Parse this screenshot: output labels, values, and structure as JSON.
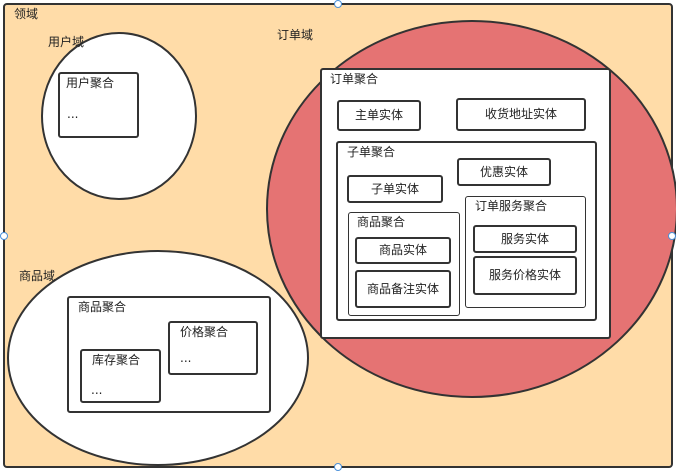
{
  "domain_label": "领域",
  "user_domain": {
    "label": "用户域",
    "user_aggregate": {
      "label": "用户聚合",
      "ellipsis": "..."
    }
  },
  "order_domain": {
    "label": "订单域",
    "order_aggregate": {
      "label": "订单聚合",
      "main_entity": "主单实体",
      "address_entity": "收货地址实体",
      "sub_aggregate": {
        "label": "子单聚合",
        "sub_entity": "子单实体",
        "discount_entity": "优惠实体",
        "product_aggregate": {
          "label": "商品聚合",
          "product_entity": "商品实体",
          "product_note_entity": "商品备注实体"
        },
        "service_aggregate": {
          "label": "订单服务聚合",
          "service_entity": "服务实体",
          "service_price_entity": "服务价格实体"
        }
      }
    }
  },
  "product_domain": {
    "label": "商品域",
    "product_aggregate": {
      "label": "商品聚合",
      "inventory_aggregate": {
        "label": "库存聚合",
        "ellipsis": "..."
      },
      "price_aggregate": {
        "label": "价格聚合",
        "ellipsis": "..."
      }
    }
  },
  "colors": {
    "domain_fill": "#FFDCA8",
    "order_domain_fill": "#E57373",
    "stroke": "#333333",
    "handle_fill": "#ffffff",
    "handle_stroke": "#4A90D9"
  }
}
